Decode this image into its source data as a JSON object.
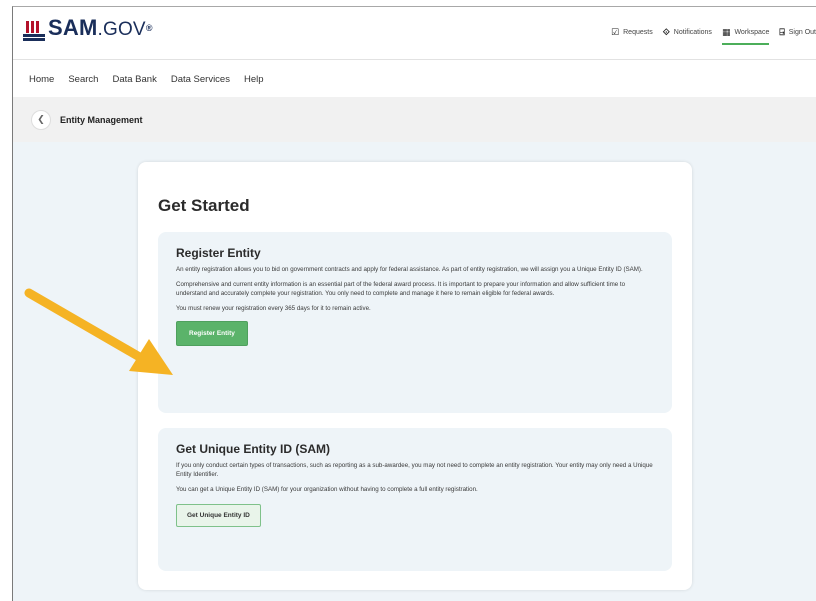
{
  "header": {
    "logo_main": "SAM",
    "logo_suffix": ".GOV",
    "logo_tm": "®",
    "links": [
      {
        "label": "Requests",
        "icon": "requests-icon"
      },
      {
        "label": "Notifications",
        "icon": "notifications-icon"
      },
      {
        "label": "Workspace",
        "icon": "workspace-icon",
        "active": true
      },
      {
        "label": "Sign Out",
        "icon": "sign-out-icon"
      }
    ]
  },
  "nav": {
    "items": [
      "Home",
      "Search",
      "Data Bank",
      "Data Services",
      "Help"
    ]
  },
  "breadcrumb": {
    "back_icon": "chevron-left-icon",
    "title": "Entity Management"
  },
  "main": {
    "title": "Get Started",
    "register": {
      "title": "Register Entity",
      "para1": "An entity registration allows you to bid on government contracts and apply for federal assistance. As part of entity registration, we will assign you a Unique Entity ID (SAM).",
      "para2": "Comprehensive and current entity information is an essential part of the federal award process. It is important to prepare your information and allow sufficient time to understand and accurately complete your registration. You only need to complete and manage it here to remain eligible for federal awards.",
      "para3": "You must renew your registration every 365 days for it to remain active.",
      "button": "Register Entity"
    },
    "uei": {
      "title": "Get Unique Entity ID (SAM)",
      "para1": "If you only conduct certain types of transactions, such as reporting as a sub-awardee, you may not need to complete an entity registration. Your entity may only need a Unique Entity Identifier.",
      "para2": "You can get a Unique Entity ID (SAM) for your organization without having to complete a full entity registration.",
      "button": "Get Unique Entity ID"
    }
  },
  "colors": {
    "accent_green": "#5bb36a",
    "brand_navy": "#1a2e5a",
    "brand_red": "#b3122a",
    "arrow": "#f5b324"
  }
}
